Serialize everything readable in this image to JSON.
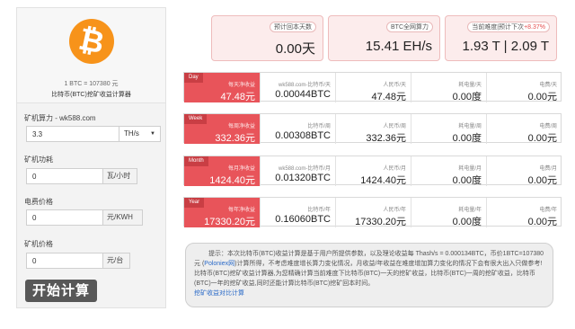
{
  "left": {
    "rate_text": "1 BTC = 107380 元",
    "calc_title": "比特币(BTC)挖矿收益计算器",
    "hashrate_label": "矿机算力 - wk588.com",
    "hashrate_value": "3.3",
    "hashrate_unit": "TH/s",
    "power_label": "矿机功耗",
    "power_value": "0",
    "power_unit": "瓦/小时",
    "electricity_label": "电费价格",
    "electricity_value": "0",
    "electricity_unit": "元/KWH",
    "machine_price_label": "矿机价格",
    "machine_price_value": "0",
    "machine_price_unit": "元/台",
    "start_button": "开始计算"
  },
  "stats": {
    "payback_label": "预计回本天数",
    "payback_value": "0.00天",
    "network_label": "BTC全网算力",
    "network_value": "15.41 EH/s",
    "difficulty_label": "当前难度|预计下次",
    "difficulty_change": "+8.37%",
    "difficulty_value": "1.93 T | 2.09 T"
  },
  "rows": [
    {
      "tag": "Day",
      "net_label": "每天净收益",
      "net_value": "47.48元",
      "btc_label": "wk588.com-比特币/天",
      "btc_value": "0.00044BTC",
      "rmb_label": "人民币/天",
      "rmb_value": "47.48元",
      "power_label": "耗电量/天",
      "power_value": "0.00度",
      "cost_label": "电费/天",
      "cost_value": "0.00元"
    },
    {
      "tag": "Week",
      "net_label": "每周净收益",
      "net_value": "332.36元",
      "btc_label": "比特币/周",
      "btc_value": "0.00308BTC",
      "rmb_label": "人民币/周",
      "rmb_value": "332.36元",
      "power_label": "耗电量/周",
      "power_value": "0.00度",
      "cost_label": "电费/周",
      "cost_value": "0.00元"
    },
    {
      "tag": "Month",
      "net_label": "每月净收益",
      "net_value": "1424.40元",
      "btc_label": "wk588.com-比特币/月",
      "btc_value": "0.01320BTC",
      "rmb_label": "人民币/月",
      "rmb_value": "1424.40元",
      "power_label": "耗电量/月",
      "power_value": "0.00度",
      "cost_label": "电费/月",
      "cost_value": "0.00元"
    },
    {
      "tag": "Year",
      "net_label": "每年净收益",
      "net_value": "17330.20元",
      "btc_label": "比特币/年",
      "btc_value": "0.16060BTC",
      "rmb_label": "人民币/年",
      "rmb_value": "17330.20元",
      "power_label": "耗电量/年",
      "power_value": "0.00度",
      "cost_label": "电费/年",
      "cost_value": "0.00元"
    }
  ],
  "note": {
    "part1": "提示：本次比特币(BTC)收益计算是基于用户所提供参数，以及理论收益每 Thash/s = 0.000134BTC，币价1BTC=107380 元 (",
    "poloniex": "Poloniex网",
    "part2": ")计算所得，不考虑难度增长算力变化情况，月收益/年收益在难度增加算力变化的情况下会有很大出入只做参考! 比特币(BTC)挖矿收益计算器,为您精确计算当前难度下比特币(BTC)一天的挖矿收益，比特币(BTC)一周的挖矿收益，比特币(BTC)一年的挖矿收益,同时还能计算比特币(BTC)挖矿回本时间。",
    "link": "挖矿收益对比计算"
  },
  "colors": {
    "accent": "#e8545a",
    "accent_dark": "#c93e44",
    "bitcoin": "#f7931a",
    "stat_bg": "#fcecec",
    "button": "#585858"
  },
  "icons": [
    "bitcoin-logo-icon",
    "chevron-down-icon"
  ]
}
